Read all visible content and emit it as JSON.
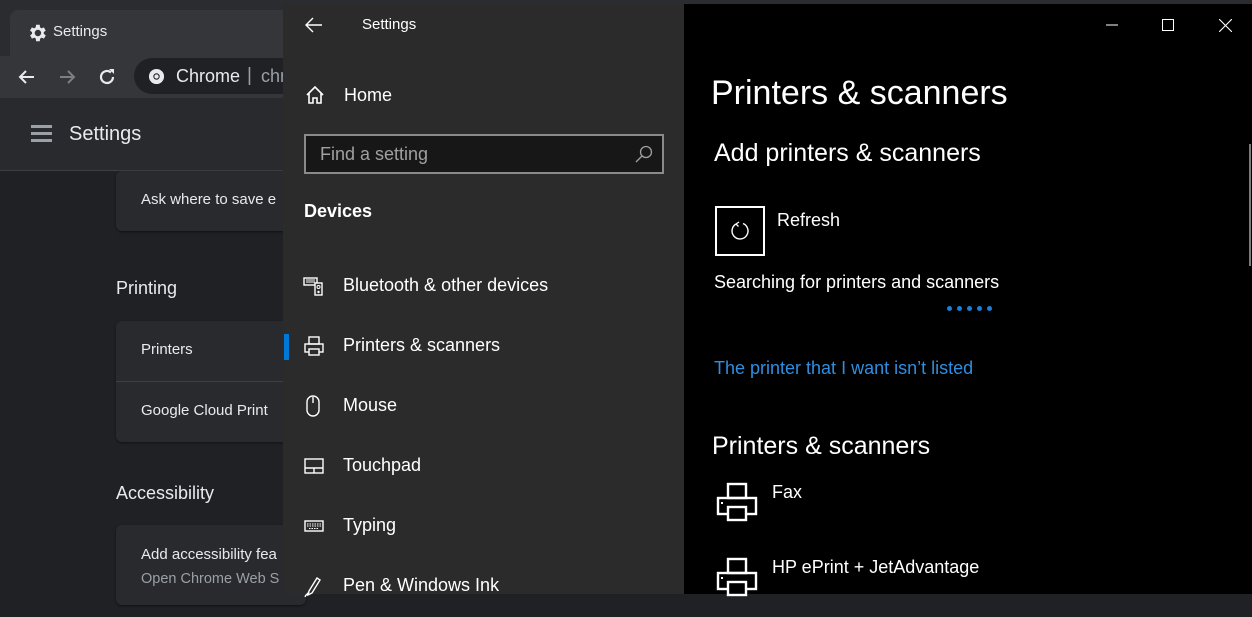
{
  "chrome": {
    "tab_title": "Settings",
    "omnibox_site": "Chrome",
    "omnibox_separator": "|",
    "omnibox_url": "chr",
    "header_title": "Settings",
    "downloads_card": {
      "row": "Ask where to save e"
    },
    "printing": {
      "title": "Printing",
      "rows": [
        "Printers",
        "Google Cloud Print"
      ]
    },
    "accessibility": {
      "title": "Accessibility",
      "row_title": "Add accessibility fea",
      "row_subtitle": "Open Chrome Web S"
    }
  },
  "settings_window": {
    "app_title": "Settings",
    "nav": {
      "home_label": "Home",
      "search_placeholder": "Find a setting",
      "group_label": "Devices",
      "items": [
        {
          "label": "Bluetooth & other devices",
          "icon": "bluetooth-devices-icon",
          "selected": false
        },
        {
          "label": "Printers & scanners",
          "icon": "printer-icon",
          "selected": true
        },
        {
          "label": "Mouse",
          "icon": "mouse-icon",
          "selected": false
        },
        {
          "label": "Touchpad",
          "icon": "touchpad-icon",
          "selected": false
        },
        {
          "label": "Typing",
          "icon": "keyboard-icon",
          "selected": false
        },
        {
          "label": "Pen & Windows Ink",
          "icon": "pen-icon",
          "selected": false
        }
      ]
    },
    "content": {
      "page_title": "Printers & scanners",
      "add_section_title": "Add printers & scanners",
      "refresh_label": "Refresh",
      "status_text": "Searching for printers and scanners",
      "not_listed_link": "The printer that I want isn’t listed",
      "list_section_title": "Printers & scanners",
      "printers": [
        "Fax",
        "HP ePrint + JetAdvantage"
      ]
    },
    "accent_color": "#0078d7",
    "link_color": "#2f8ee0"
  }
}
